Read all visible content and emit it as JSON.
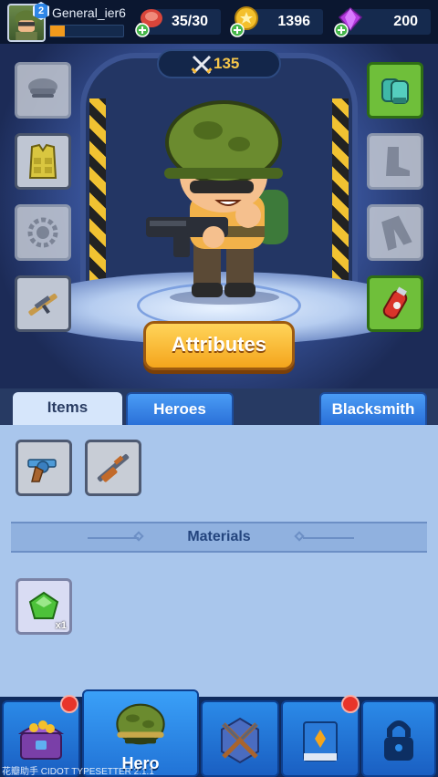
{
  "player": {
    "level": "2",
    "username": "General_ier6",
    "xp_fraction": 0.2
  },
  "resources": {
    "energy": "35/30",
    "coins": "1396",
    "gems": "200"
  },
  "hero_scene": {
    "power": "135",
    "attributes_label": "Attributes"
  },
  "equipment_slots": {
    "left": [
      "hat-icon",
      "vest-icon",
      "gear-badge-icon",
      "rifle-icon"
    ],
    "right": [
      "gloves-icon",
      "boots-icon",
      "pants-icon",
      "grenade-icon"
    ]
  },
  "tabs": {
    "items": "Items",
    "heroes": "Heroes",
    "blacksmith": "Blacksmith"
  },
  "inventory": {
    "items": [
      "revolver-icon",
      "shotgun-icon"
    ],
    "materials_title": "Materials",
    "materials": [
      {
        "icon": "green-gem-icon",
        "qty": "x1"
      }
    ]
  },
  "bottom_nav": {
    "hero_label": "Hero"
  },
  "watermark": "花瓣助手 CIDOT TYPESETTER 2.1.1",
  "colors": {
    "accent_orange": "#f4a51c",
    "tab_blue": "#2a70d8",
    "inventory_bg": "#a9c6ec",
    "notification_red": "#e8342a"
  }
}
